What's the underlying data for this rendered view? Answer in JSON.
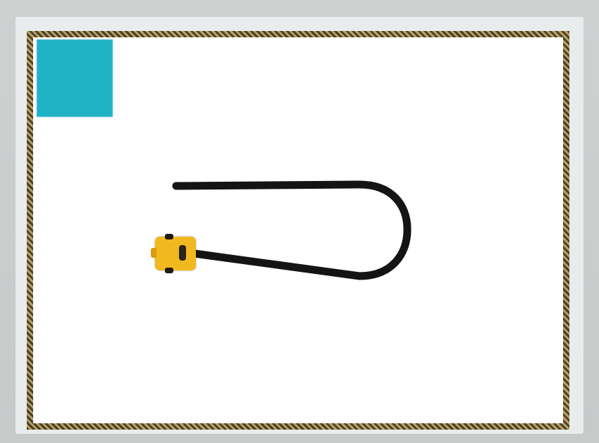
{
  "scene": {
    "start_tile": {
      "color": "#20b3c6"
    },
    "track": {
      "color": "#141414"
    },
    "robot": {
      "color": "#f2b81f"
    },
    "border": {
      "dark": "#4a3f26",
      "light": "#b8a268"
    }
  }
}
